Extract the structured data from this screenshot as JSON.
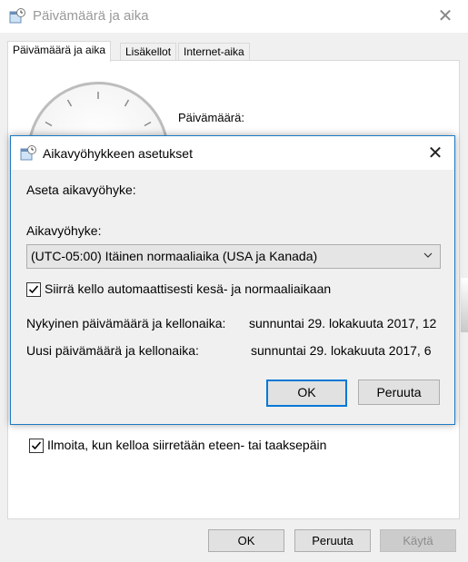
{
  "back_window": {
    "title": "Päivämäärä ja aika",
    "tabs": [
      {
        "label": "Päivämäärä ja aika",
        "active": true
      },
      {
        "label": "Lisäkellot",
        "active": false
      },
      {
        "label": "Internet-aika",
        "active": false
      }
    ],
    "date_label": "Päivämäärä:",
    "notify_checkbox": {
      "label": "Ilmoita, kun kelloa siirretään eteen- tai taaksepäin",
      "checked": true
    },
    "footer": {
      "ok_label": "OK",
      "cancel_label": "Peruuta",
      "apply_label": "Käytä"
    }
  },
  "dialog": {
    "title": "Aikavyöhykkeen asetukset",
    "instruction": "Aseta aikavyöhyke:",
    "timezone_label": "Aikavyöhyke:",
    "timezone_value": "(UTC-05:00) Itäinen normaaliaika (USA ja Kanada)",
    "dst_checkbox": {
      "label": "Siirrä kello automaattisesti kesä- ja normaaliaikaan",
      "checked": true
    },
    "current_label": "Nykyinen päivämäärä ja kellonaika:",
    "current_value": "sunnuntai 29. lokakuuta 2017, 12",
    "new_label": "Uusi päivämäärä ja kellonaika:",
    "new_value": "sunnuntai 29. lokakuuta 2017, 6",
    "ok_label": "OK",
    "cancel_label": "Peruuta"
  },
  "colors": {
    "accent": "#0078d7",
    "dialog_border": "#1c7ac4",
    "window_bg": "#f0f0f0"
  },
  "icons": [
    "datetime-icon",
    "close-icon",
    "chevron-down-icon",
    "checkmark-icon"
  ]
}
